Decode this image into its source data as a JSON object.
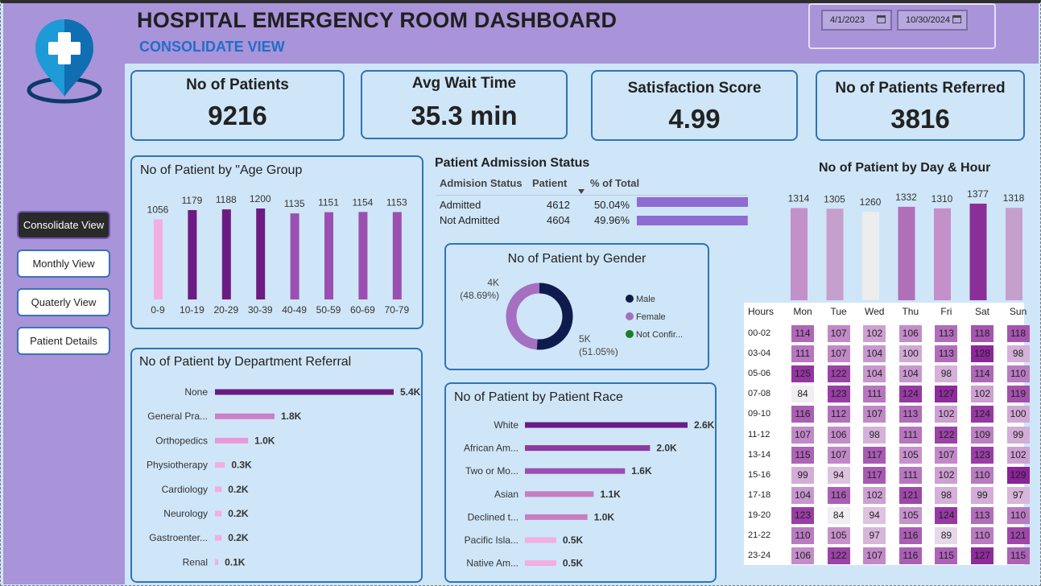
{
  "header": {
    "title": "HOSPITAL EMERGENCY ROOM DASHBOARD",
    "subtitle": "CONSOLIDATE VIEW",
    "date_from": "4/1/2023",
    "date_to": "10/30/2024"
  },
  "sidebar": {
    "items": [
      {
        "label": "Consolidate View",
        "active": true
      },
      {
        "label": "Monthly View",
        "active": false
      },
      {
        "label": "Quaterly View",
        "active": false
      },
      {
        "label": "Patient Details",
        "active": false
      }
    ]
  },
  "kpis": [
    {
      "label": "No of Patients",
      "value": "9216"
    },
    {
      "label": "Avg Wait Time",
      "value": "35.3 min"
    },
    {
      "label": "Satisfaction Score",
      "value": "4.99"
    },
    {
      "label": "No of Patients Referred",
      "value": "3816"
    }
  ],
  "colors": {
    "accent_dark": "#6c1b82",
    "accent_mid": "#9b4fb0",
    "accent_light": "#f2aee0",
    "male": "#0e1b4d",
    "female": "#a56fc2",
    "not_confirmed": "#1a7f2a",
    "bar_purple": "#8e6bd1"
  },
  "admission": {
    "title": "Patient Admission Status",
    "headers": [
      "Admision Status",
      "Patient",
      "% of Total"
    ],
    "rows": [
      {
        "status": "Admitted",
        "patients": "4612",
        "pct": "50.04%",
        "fraction": 0.5004
      },
      {
        "status": "Not Admitted",
        "patients": "4604",
        "pct": "49.96%",
        "fraction": 0.4996
      }
    ]
  },
  "chart_data": [
    {
      "type": "bar",
      "title": "No of Patient by \"Age Group",
      "categories": [
        "0-9",
        "10-19",
        "20-29",
        "30-39",
        "40-49",
        "50-59",
        "60-69",
        "70-79"
      ],
      "values": [
        1056,
        1179,
        1188,
        1200,
        1135,
        1151,
        1154,
        1153
      ],
      "labels": [
        "1056",
        "1179",
        "1188",
        "1200",
        "1135",
        "1151",
        "1154",
        "1153"
      ]
    },
    {
      "type": "bar",
      "orientation": "horizontal",
      "title": "No of Patient by Department Referral",
      "categories": [
        "None",
        "General Pra...",
        "Orthopedics",
        "Physiotherapy",
        "Cardiology",
        "Neurology",
        "Gastroenter...",
        "Renal"
      ],
      "values": [
        5.4,
        1.8,
        1.0,
        0.3,
        0.2,
        0.2,
        0.2,
        0.1
      ],
      "labels": [
        "5.4K",
        "1.8K",
        "1.0K",
        "0.3K",
        "0.2K",
        "0.2K",
        "0.2K",
        "0.1K"
      ]
    },
    {
      "type": "pie",
      "title": "No of Patient by Gender",
      "categories": [
        "Male",
        "Female",
        "Not Confir..."
      ],
      "values": [
        5,
        4,
        0
      ],
      "slice_labels": {
        "female_value": "4K",
        "female_pct": "(48.69%)",
        "male_value": "5K",
        "male_pct": "(51.05%)"
      }
    },
    {
      "type": "bar",
      "orientation": "horizontal",
      "title": "No of Patient by Patient Race",
      "categories": [
        "White",
        "African Am...",
        "Two or Mo...",
        "Asian",
        "Declined t...",
        "Pacific Isla...",
        "Native Am..."
      ],
      "values": [
        2.6,
        2.0,
        1.6,
        1.1,
        1.0,
        0.5,
        0.5
      ],
      "labels": [
        "2.6K",
        "2.0K",
        "1.6K",
        "1.1K",
        "1.0K",
        "0.5K",
        "0.5K"
      ]
    },
    {
      "type": "bar",
      "title": "No of Patient by Day & Hour",
      "categories": [
        "Mon",
        "Tue",
        "Wed",
        "Thu",
        "Fri",
        "Sat",
        "Sun"
      ],
      "values": [
        1314,
        1305,
        1260,
        1332,
        1310,
        1377,
        1318
      ],
      "labels": [
        "1314",
        "1305",
        "1260",
        "1332",
        "1310",
        "1377",
        "1318"
      ]
    },
    {
      "type": "heatmap",
      "row_header": "Hours",
      "columns": [
        "Mon",
        "Tue",
        "Wed",
        "Thu",
        "Fri",
        "Sat",
        "Sun"
      ],
      "rows": [
        "00-02",
        "03-04",
        "05-06",
        "07-08",
        "09-10",
        "11-12",
        "13-14",
        "15-16",
        "17-18",
        "19-20",
        "21-22",
        "23-24"
      ],
      "values": [
        [
          114,
          107,
          102,
          106,
          113,
          118,
          118
        ],
        [
          111,
          107,
          104,
          100,
          113,
          128,
          98
        ],
        [
          125,
          122,
          104,
          104,
          98,
          114,
          110
        ],
        [
          84,
          123,
          111,
          124,
          127,
          102,
          119
        ],
        [
          116,
          112,
          107,
          113,
          102,
          124,
          100
        ],
        [
          107,
          106,
          98,
          111,
          122,
          109,
          99
        ],
        [
          115,
          107,
          117,
          105,
          107,
          123,
          102
        ],
        [
          99,
          94,
          117,
          111,
          102,
          110,
          129
        ],
        [
          104,
          116,
          102,
          121,
          98,
          99,
          97
        ],
        [
          123,
          84,
          94,
          105,
          124,
          113,
          110
        ],
        [
          110,
          105,
          97,
          116,
          89,
          110,
          121
        ],
        [
          106,
          122,
          107,
          116,
          115,
          127,
          115
        ]
      ]
    }
  ]
}
